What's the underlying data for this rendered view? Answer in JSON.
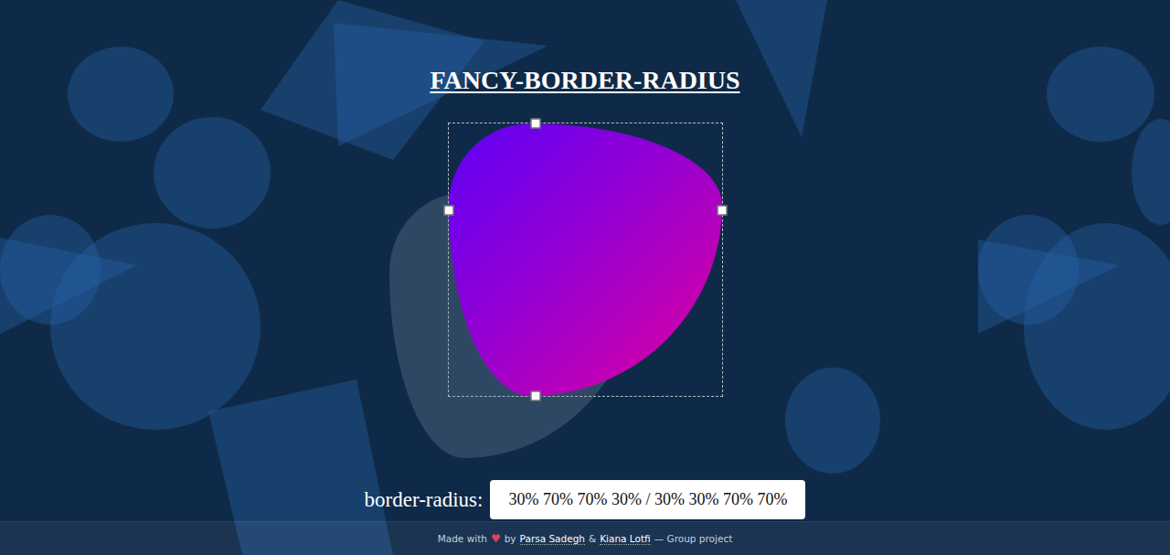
{
  "page": {
    "title": "FANCY-BORDER-RADIUS"
  },
  "editor": {
    "handles": [
      {
        "side": "top",
        "level": 0.32
      },
      {
        "side": "right",
        "level": 0.32
      },
      {
        "side": "bottom",
        "level": 0.32
      },
      {
        "side": "left",
        "level": 0.32
      }
    ]
  },
  "control": {
    "label": "border-radius:",
    "value": "30% 70% 70% 30% / 30% 30% 70% 70%"
  },
  "footer": {
    "prefix": "Made with",
    "heart": "♥",
    "by": "by",
    "authors": [
      "Parsa Sadegh",
      "Kiana Lotfi"
    ],
    "joiner": "&",
    "suffix": "— Group project"
  }
}
